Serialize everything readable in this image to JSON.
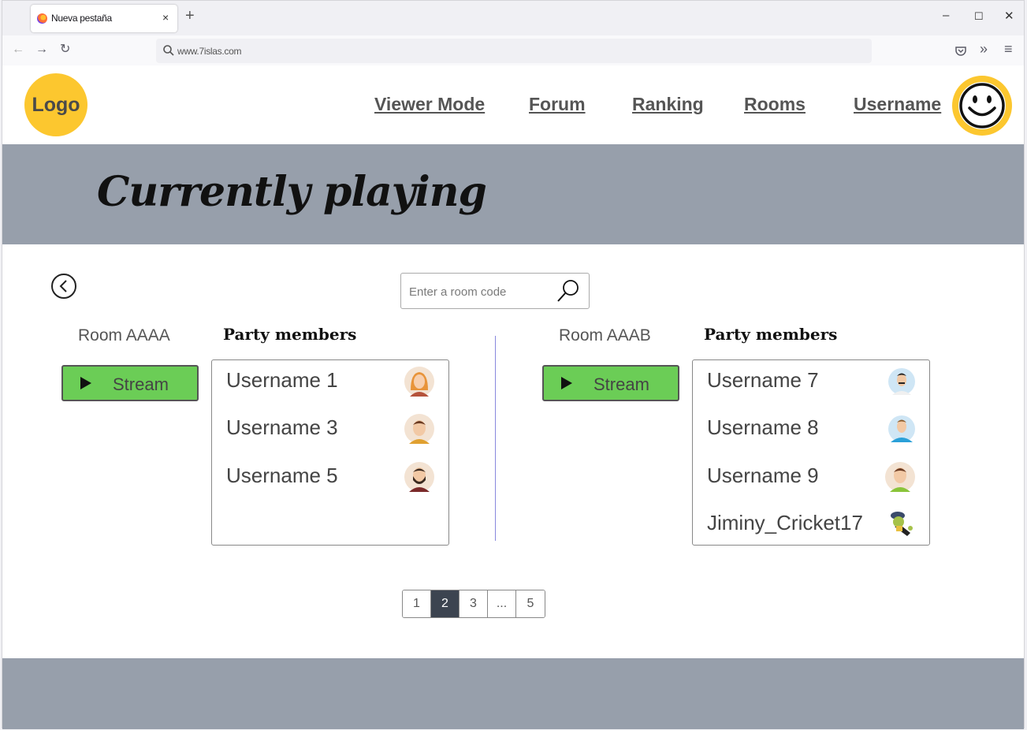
{
  "browser": {
    "tab_title": "Nueva pestaña",
    "tab_close": "×",
    "new_tab": "+",
    "url": "www.7islas.com",
    "window_controls": {
      "minimize": "–",
      "maximize": "☐",
      "close": "✕"
    },
    "nav_icons": {
      "back": "←",
      "forward": "→",
      "reload": "↻",
      "pocket": "pocket-icon",
      "overflow": "»",
      "menu": "≡"
    }
  },
  "header": {
    "logo": "Logo",
    "nav": [
      "Viewer Mode",
      "Forum",
      "Ranking",
      "Rooms"
    ],
    "username": "Username",
    "avatar_icon": "smiley-face-icon"
  },
  "banner": {
    "title": "Currently playing"
  },
  "search": {
    "placeholder": "Enter a room code"
  },
  "rooms": [
    {
      "label": "Room  AAAA",
      "party_label": "Party members",
      "stream_label": "Stream",
      "members": [
        {
          "name": "Username 1",
          "avatar": "woman-red-hair-avatar"
        },
        {
          "name": "Username 3",
          "avatar": "man-brown-hair-avatar"
        },
        {
          "name": "Username 5",
          "avatar": "bearded-man-avatar"
        }
      ]
    },
    {
      "label": "Room  AAAB",
      "party_label": "Party members",
      "stream_label": "Stream",
      "members": [
        {
          "name": "Username 7",
          "avatar": "man-mustache-avatar"
        },
        {
          "name": "Username 8",
          "avatar": "man-blue-shirt-avatar"
        },
        {
          "name": "Username 9",
          "avatar": "man-green-shirt-avatar"
        },
        {
          "name": "Jiminy_Cricket17",
          "avatar": "jiminy-cricket-avatar"
        }
      ]
    }
  ],
  "pagination": {
    "pages": [
      "1",
      "2",
      "3",
      "...",
      "5"
    ],
    "current": "2"
  },
  "colors": {
    "accent_yellow": "#fcc72f",
    "banner_gray": "#979fab",
    "stream_green": "#6bcd56",
    "pager_active": "#3c4450"
  }
}
